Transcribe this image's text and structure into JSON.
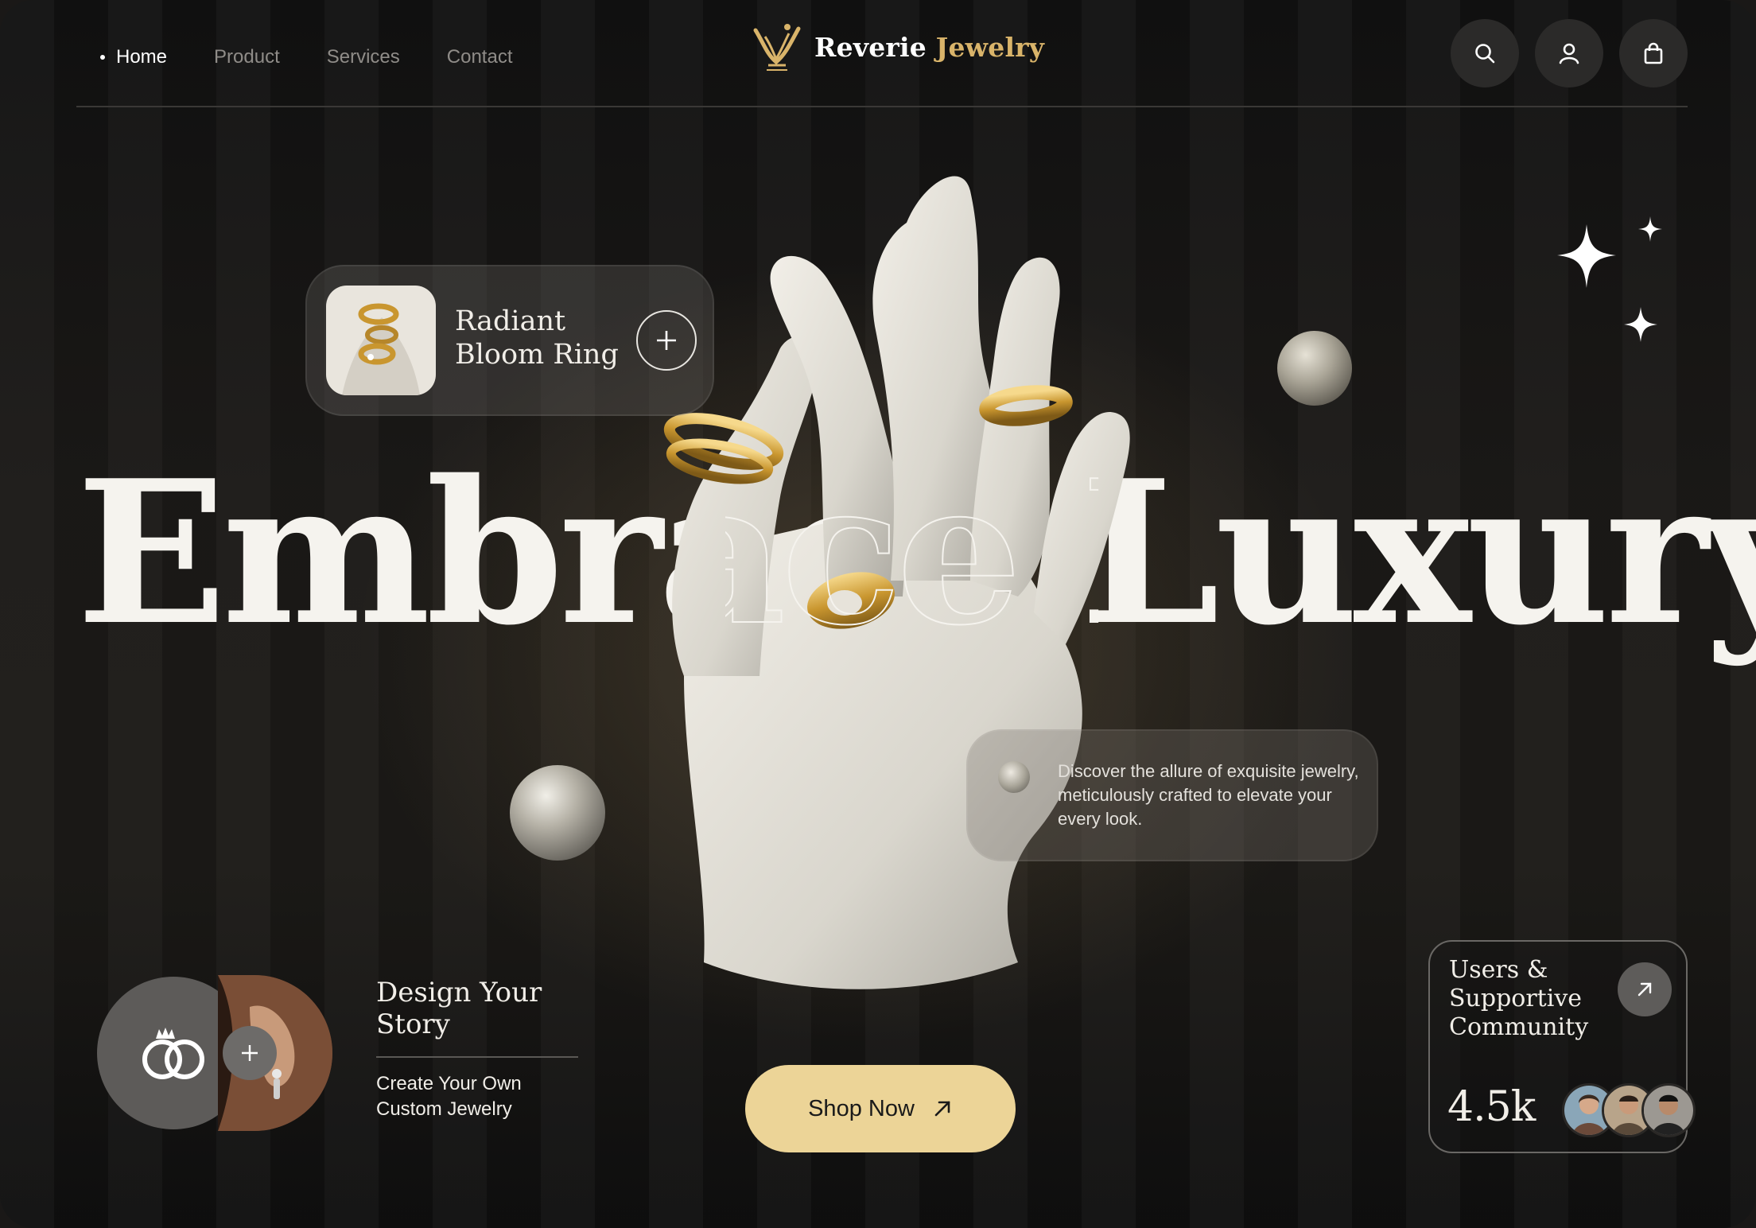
{
  "nav": {
    "items": [
      {
        "label": "Home",
        "active": true
      },
      {
        "label": "Product",
        "active": false
      },
      {
        "label": "Services",
        "active": false
      },
      {
        "label": "Contact",
        "active": false
      }
    ],
    "brand_primary": "Reverie",
    "brand_secondary": "Jewelry",
    "icons": [
      "search-icon",
      "user-icon",
      "shopping-bag-icon"
    ]
  },
  "hero": {
    "headline": "Embrace Luxury"
  },
  "product_card": {
    "title": "Radiant Bloom Ring",
    "icon": "plus-icon"
  },
  "description": {
    "text": "Discover the allure of exquisite jewelry, meticulously crafted to elevate your every look."
  },
  "custom": {
    "title": "Design Your Story",
    "subtitle": "Create Your Own Custom Jewelry",
    "icon": "rings-icon"
  },
  "cta": {
    "label": "Shop Now",
    "icon": "arrow-up-right-icon"
  },
  "community": {
    "title": "Users & Supportive Community",
    "count": "4.5k",
    "icon": "arrow-up-right-icon"
  },
  "colors": {
    "background": "#1a1817",
    "accent_gold": "#d9b46a",
    "button_gold": "#ecd497",
    "card": "#5d5b59"
  }
}
